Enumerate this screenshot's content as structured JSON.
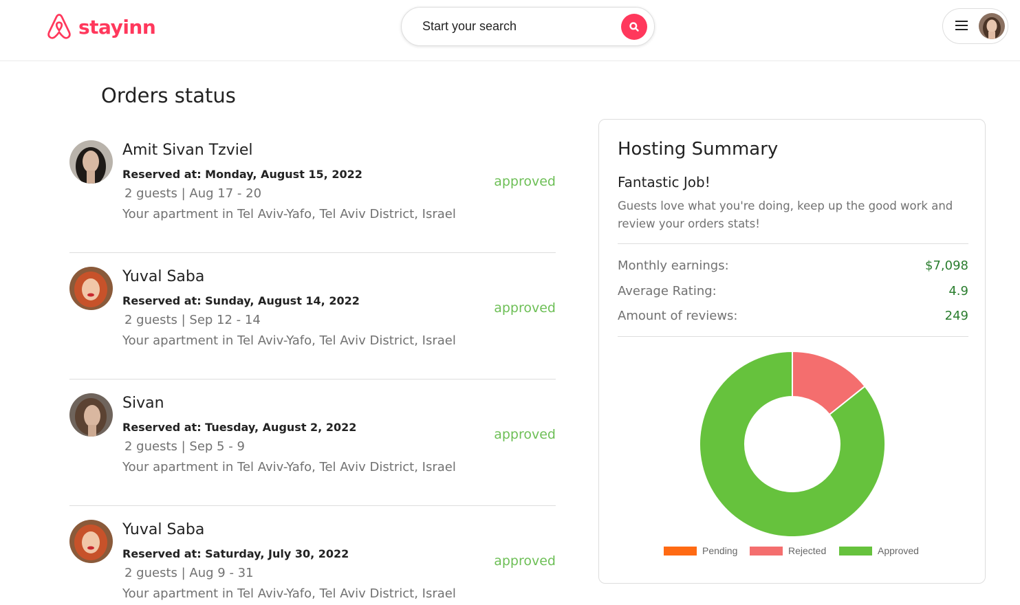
{
  "header": {
    "logo_text": "stayinn",
    "search_placeholder": "Start your search",
    "icons": {
      "logo": "airbnb-logo-icon",
      "search": "search-icon",
      "menu": "hamburger-menu-icon"
    }
  },
  "page_title": "Orders status",
  "orders": [
    {
      "name": "Amit Sivan Tzviel",
      "reserved": "Reserved at: Monday, August 15, 2022",
      "guests": "2 guests |  Aug 17 - 20",
      "location": "Your apartment in Tel Aviv-Yafo, Tel Aviv District, Israel",
      "status": "approved"
    },
    {
      "name": "Yuval Saba",
      "reserved": "Reserved at: Sunday, August 14, 2022",
      "guests": "2 guests |  Sep 12 - 14",
      "location": "Your apartment in Tel Aviv-Yafo, Tel Aviv District, Israel",
      "status": "approved"
    },
    {
      "name": "Sivan",
      "reserved": "Reserved at: Tuesday, August 2, 2022",
      "guests": "2 guests |  Sep 5 - 9",
      "location": "Your apartment in Tel Aviv-Yafo, Tel Aviv District, Israel",
      "status": "approved"
    },
    {
      "name": "Yuval Saba",
      "reserved": "Reserved at: Saturday, July 30, 2022",
      "guests": "2 guests |  Aug 9 - 31",
      "location": "Your apartment in Tel Aviv-Yafo, Tel Aviv District, Israel",
      "status": "approved"
    }
  ],
  "summary": {
    "title": "Hosting Summary",
    "subtitle": "Fantastic Job!",
    "description": "Guests love what you're doing, keep up the good work and review your orders stats!",
    "stats": [
      {
        "label": "Monthly earnings:",
        "value": "$7,098"
      },
      {
        "label": "Average Rating:",
        "value": "4.9"
      },
      {
        "label": "Amount of reviews:",
        "value": "249"
      }
    ]
  },
  "colors": {
    "brand": "#ff385c",
    "approved_text": "#6dbf56",
    "stat_value": "#2a7d2e",
    "pending": "#ff6a13",
    "rejected": "#f46e6e",
    "approved": "#66c23d"
  },
  "chart_data": {
    "type": "pie",
    "donut": true,
    "categories": [
      "Pending",
      "Rejected",
      "Approved"
    ],
    "values": [
      0,
      1,
      6
    ],
    "colors": [
      "#ff6a13",
      "#f46e6e",
      "#66c23d"
    ],
    "legend": "bottom"
  }
}
